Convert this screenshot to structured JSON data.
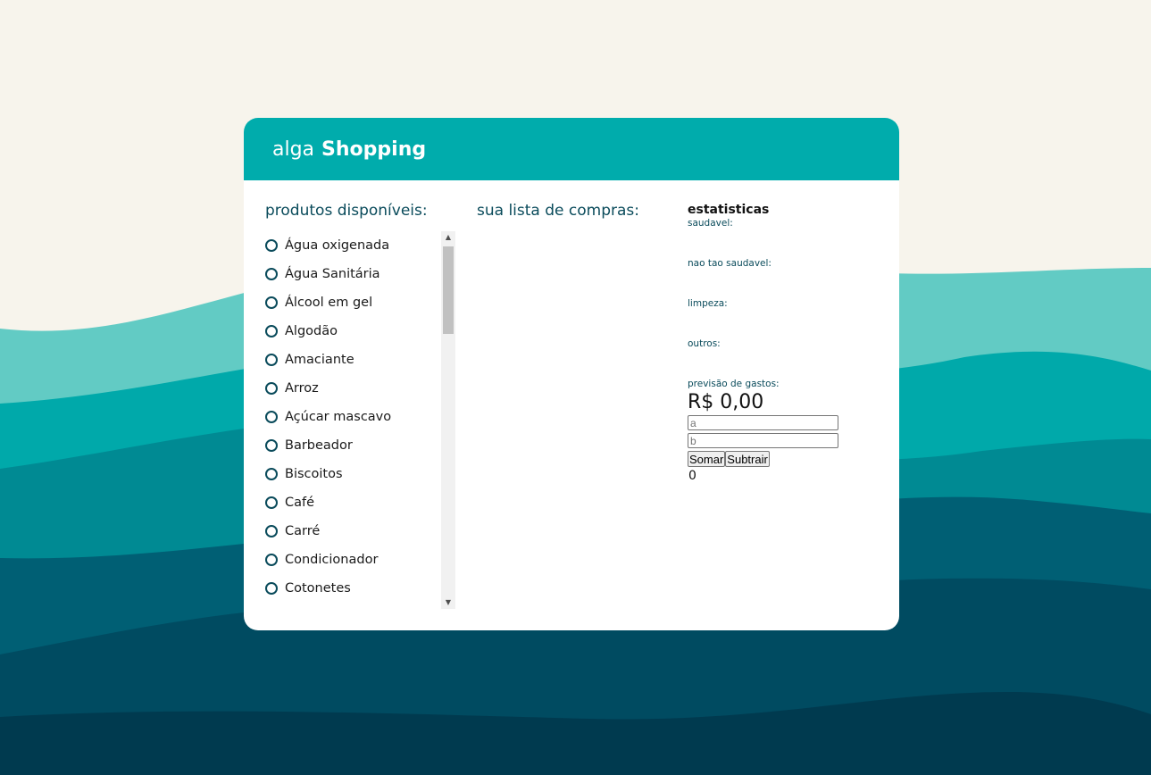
{
  "header": {
    "brand_light": "alga",
    "brand_bold": "Shopping"
  },
  "products": {
    "title": "produtos disponíveis:",
    "items": [
      "Água oxigenada",
      "Água Sanitária",
      "Álcool em gel",
      "Algodão",
      "Amaciante",
      "Arroz",
      "Açúcar mascavo",
      "Barbeador",
      "Biscoitos",
      "Café",
      "Carré",
      "Condicionador",
      "Cotonetes"
    ]
  },
  "cart": {
    "title": "sua lista de compras:"
  },
  "stats": {
    "title": "estatisticas",
    "labels": [
      "saudavel:",
      "nao tao saudavel:",
      "limpeza:",
      "outros:",
      "previsão de gastos:"
    ],
    "total": "R$ 0,00",
    "input_a_placeholder": "a",
    "input_b_placeholder": "b",
    "add_label": "Somar",
    "subtract_label": "Subtrair",
    "result": "0"
  },
  "colors": {
    "accent": "#00acac",
    "heading_text": "#0a4b5b",
    "background": "#f7f4ec"
  }
}
